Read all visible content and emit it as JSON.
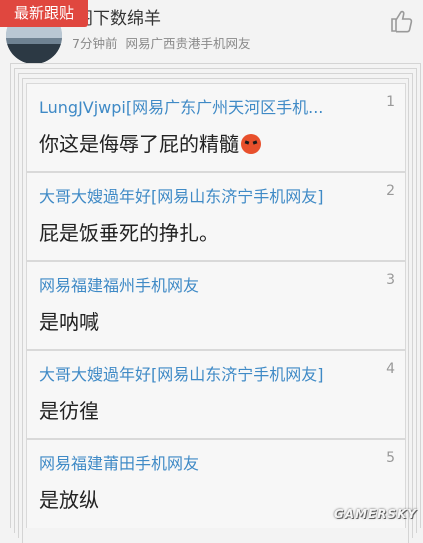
{
  "badge": "最新跟贴",
  "post": {
    "username": "阁下数绵羊",
    "time": "7分钟前",
    "location": "网易广西贵港手机网友"
  },
  "floors": [
    {
      "author": "LungJVjwpi[网易广东广州天河区手机...",
      "number": "1",
      "text": "你这是侮辱了屁的精髓",
      "emoji": "angry-face"
    },
    {
      "author": "大哥大嫂過年好[网易山东济宁手机网友]",
      "number": "2",
      "text": "屁是饭垂死的挣扎。"
    },
    {
      "author": "网易福建福州手机网友",
      "number": "3",
      "text": "是呐喊"
    },
    {
      "author": "大哥大嫂過年好[网易山东济宁手机网友]",
      "number": "4",
      "text": "是彷徨"
    },
    {
      "author": "网易福建莆田手机网友",
      "number": "5",
      "text": "是放纵"
    }
  ],
  "watermark": "GAMERSKY",
  "icons": {
    "like": "thumbs-up-icon",
    "avatar": "avatar"
  }
}
